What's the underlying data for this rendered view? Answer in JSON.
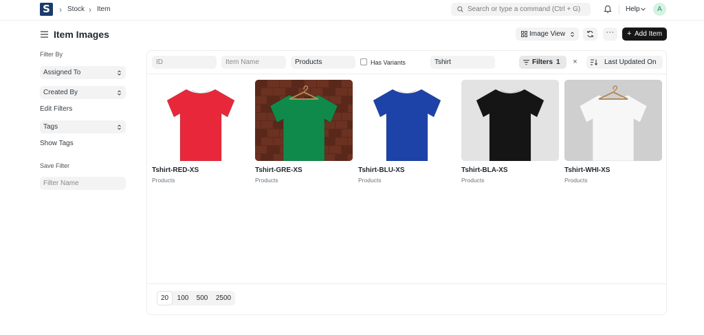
{
  "navbar": {
    "logo_letter": "S",
    "breadcrumbs": [
      "Stock",
      "Item"
    ],
    "search_placeholder": "Search or type a command (Ctrl + G)",
    "help_label": "Help",
    "avatar_initial": "A"
  },
  "header": {
    "title": "Item Images",
    "view_label": "Image View",
    "more_label": "···",
    "add_label": "Add Item"
  },
  "sidebar": {
    "filter_by": "Filter By",
    "assigned_to": "Assigned To",
    "created_by": "Created By",
    "edit_filters": "Edit Filters",
    "tags": "Tags",
    "show_tags": "Show Tags",
    "save_filter": "Save Filter",
    "filter_name_placeholder": "Filter Name"
  },
  "filters": {
    "id_placeholder": "ID",
    "item_name_placeholder": "Item Name",
    "item_group_value": "Products",
    "has_variants_label": "Has Variants",
    "variant_of_value": "Tshirt",
    "filters_label": "Filters",
    "filters_count": "1",
    "clear_label": "×",
    "sort_label": "Last Updated On"
  },
  "items": [
    {
      "name": "Tshirt-RED-XS",
      "group": "Products",
      "shirt_color": "#e8283a",
      "bg": "#ffffff"
    },
    {
      "name": "Tshirt-GRE-XS",
      "group": "Products",
      "shirt_color": "#0f8a4a",
      "bg": "#5a2a1c"
    },
    {
      "name": "Tshirt-BLU-XS",
      "group": "Products",
      "shirt_color": "#1d43a8",
      "bg": "#ffffff"
    },
    {
      "name": "Tshirt-BLA-XS",
      "group": "Products",
      "shirt_color": "#151515",
      "bg": "#e3e3e3"
    },
    {
      "name": "Tshirt-WHI-XS",
      "group": "Products",
      "shirt_color": "#f7f7f7",
      "bg": "#cfcfcf"
    }
  ],
  "paging": [
    "20",
    "100",
    "500",
    "2500"
  ],
  "paging_selected": "20"
}
